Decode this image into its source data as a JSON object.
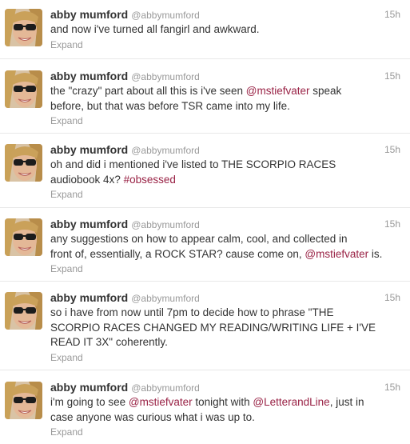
{
  "tweets": [
    {
      "fullname": "abby mumford",
      "username": "@abbymumford",
      "time": "15h",
      "parts": [
        {
          "t": "text",
          "v": "and now i've turned all fangirl and awkward."
        }
      ],
      "expand": "Expand"
    },
    {
      "fullname": "abby mumford",
      "username": "@abbymumford",
      "time": "15h",
      "parts": [
        {
          "t": "text",
          "v": "the \"crazy\" part about all this is i've seen "
        },
        {
          "t": "mention",
          "v": "@mstiefvater"
        },
        {
          "t": "text",
          "v": " speak\nbefore, but that was before TSR came into my life."
        }
      ],
      "expand": "Expand"
    },
    {
      "fullname": "abby mumford",
      "username": "@abbymumford",
      "time": "15h",
      "parts": [
        {
          "t": "text",
          "v": "oh and did i mentioned i've listed to THE SCORPIO RACES\naudiobook 4x? "
        },
        {
          "t": "hashtag",
          "v": "#obsessed"
        }
      ],
      "expand": "Expand"
    },
    {
      "fullname": "abby mumford",
      "username": "@abbymumford",
      "time": "15h",
      "parts": [
        {
          "t": "text",
          "v": "any suggestions on how to appear calm, cool, and collected in\nfront of, essentially, a ROCK STAR? cause come on, "
        },
        {
          "t": "mention",
          "v": "@mstiefvater"
        },
        {
          "t": "text",
          "v": " is."
        }
      ],
      "expand": "Expand"
    },
    {
      "fullname": "abby mumford",
      "username": "@abbymumford",
      "time": "15h",
      "parts": [
        {
          "t": "text",
          "v": "so i have from now until 7pm to decide how to phrase \"THE\nSCORPIO RACES CHANGED MY READING/WRITING LIFE + I'VE\nREAD IT 3X\" coherently."
        }
      ],
      "expand": "Expand"
    },
    {
      "fullname": "abby mumford",
      "username": "@abbymumford",
      "time": "15h",
      "parts": [
        {
          "t": "text",
          "v": "i'm going to see "
        },
        {
          "t": "mention",
          "v": "@mstiefvater"
        },
        {
          "t": "text",
          "v": " tonight with "
        },
        {
          "t": "mention",
          "v": "@LetterandLine"
        },
        {
          "t": "text",
          "v": ", just in\ncase anyone was curious what i was up to."
        }
      ],
      "expand": "Expand"
    }
  ],
  "colors": {
    "link": "#992245",
    "muted": "#999999",
    "text": "#333333"
  },
  "icons": {
    "avatar": "profile-photo-sunglasses"
  }
}
